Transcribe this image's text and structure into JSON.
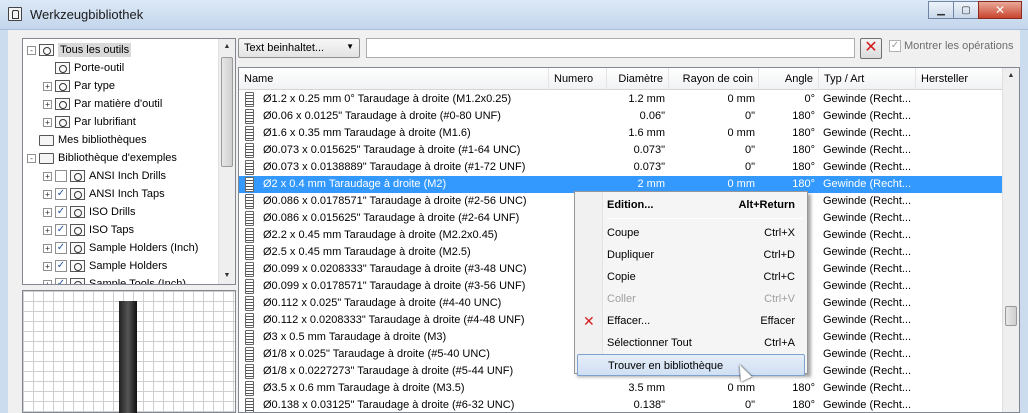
{
  "window": {
    "title": "Werkzeugbibliothek"
  },
  "tree": {
    "items": [
      {
        "label": "Tous les outils",
        "level": 0,
        "expander": "-",
        "icon": "library-icon",
        "selected": true
      },
      {
        "label": "Porte-outil",
        "level": 1,
        "expander": "",
        "icon": "tool-holder-icon"
      },
      {
        "label": "Par type",
        "level": 1,
        "expander": "+",
        "icon": "tool-type-icon"
      },
      {
        "label": "Par matière d'outil",
        "level": 1,
        "expander": "+",
        "icon": "tool-material-icon"
      },
      {
        "label": "Par lubrifiant",
        "level": 1,
        "expander": "+",
        "icon": "coolant-icon"
      },
      {
        "label": "Mes bibliothèques",
        "level": 0,
        "expander": "",
        "icon": "folder-icon"
      },
      {
        "label": "Bibliothèque d'exemples",
        "level": 0,
        "expander": "-",
        "icon": "folder-icon"
      },
      {
        "label": "ANSI Inch Drills",
        "level": 1,
        "expander": "+",
        "checked": false,
        "icon": "library-icon"
      },
      {
        "label": "ANSI Inch Taps",
        "level": 1,
        "expander": "+",
        "checked": true,
        "icon": "library-icon"
      },
      {
        "label": "ISO Drills",
        "level": 1,
        "expander": "+",
        "checked": true,
        "icon": "library-icon"
      },
      {
        "label": "ISO Taps",
        "level": 1,
        "expander": "+",
        "checked": true,
        "icon": "library-icon"
      },
      {
        "label": "Sample Holders (Inch)",
        "level": 1,
        "expander": "+",
        "checked": true,
        "icon": "library-icon"
      },
      {
        "label": "Sample Holders",
        "level": 1,
        "expander": "+",
        "checked": true,
        "icon": "library-icon"
      },
      {
        "label": "Sample Tools (Inch)",
        "level": 1,
        "expander": "+",
        "checked": true,
        "icon": "library-icon"
      }
    ]
  },
  "toolbar": {
    "filter_mode": "Text beinhaltet...",
    "search_value": "",
    "search_placeholder": "",
    "show_operations_label": "Montrer les opérations",
    "show_operations_checked": true
  },
  "grid": {
    "columns": [
      "Name",
      "Numero",
      "Diamètre",
      "Rayon de coin",
      "Angle",
      "Typ / Art",
      "Hersteller"
    ],
    "selected_row": 5,
    "rows": [
      {
        "name": "Ø1.2 x 0.25 mm 0° Taraudage à droite (M1.2x0.25)",
        "numero": "",
        "diametre": "1.2 mm",
        "rayon": "0 mm",
        "angle": "0°",
        "type": "Gewinde (Recht..."
      },
      {
        "name": "Ø0.06 x 0.0125\" Taraudage à droite (#0-80 UNF)",
        "numero": "",
        "diametre": "0.06\"",
        "rayon": "0\"",
        "angle": "180°",
        "type": "Gewinde (Recht..."
      },
      {
        "name": "Ø1.6 x 0.35 mm Taraudage à droite (M1.6)",
        "numero": "",
        "diametre": "1.6 mm",
        "rayon": "0 mm",
        "angle": "180°",
        "type": "Gewinde (Recht..."
      },
      {
        "name": "Ø0.073 x 0.015625\" Taraudage à droite (#1-64 UNC)",
        "numero": "",
        "diametre": "0.073\"",
        "rayon": "0\"",
        "angle": "180°",
        "type": "Gewinde (Recht..."
      },
      {
        "name": "Ø0.073 x 0.0138889\" Taraudage à droite (#1-72 UNF)",
        "numero": "",
        "diametre": "0.073\"",
        "rayon": "0\"",
        "angle": "180°",
        "type": "Gewinde (Recht..."
      },
      {
        "name": "Ø2 x 0.4 mm Taraudage à droite (M2)",
        "numero": "",
        "diametre": "2 mm",
        "rayon": "0 mm",
        "angle": "180°",
        "type": "Gewinde (Recht..."
      },
      {
        "name": "Ø0.086 x 0.0178571\" Taraudage à droite (#2-56 UNC)",
        "numero": "",
        "diametre": "",
        "rayon": "",
        "angle": "",
        "type": "Gewinde (Recht..."
      },
      {
        "name": "Ø0.086 x 0.015625\" Taraudage à droite (#2-64 UNF)",
        "numero": "",
        "diametre": "",
        "rayon": "",
        "angle": "",
        "type": "Gewinde (Recht..."
      },
      {
        "name": "Ø2.2 x 0.45 mm Taraudage à droite (M2.2x0.45)",
        "numero": "",
        "diametre": "",
        "rayon": "",
        "angle": "",
        "type": "Gewinde (Recht..."
      },
      {
        "name": "Ø2.5 x 0.45 mm Taraudage à droite (M2.5)",
        "numero": "",
        "diametre": "",
        "rayon": "",
        "angle": "",
        "type": "Gewinde (Recht..."
      },
      {
        "name": "Ø0.099 x 0.0208333\" Taraudage à droite (#3-48 UNC)",
        "numero": "",
        "diametre": "",
        "rayon": "",
        "angle": "",
        "type": "Gewinde (Recht..."
      },
      {
        "name": "Ø0.099 x 0.0178571\" Taraudage à droite (#3-56 UNF)",
        "numero": "",
        "diametre": "",
        "rayon": "",
        "angle": "",
        "type": "Gewinde (Recht..."
      },
      {
        "name": "Ø0.112 x 0.025\" Taraudage à droite (#4-40 UNC)",
        "numero": "",
        "diametre": "",
        "rayon": "",
        "angle": "",
        "type": "Gewinde (Recht..."
      },
      {
        "name": "Ø0.112 x 0.0208333\" Taraudage à droite (#4-48 UNF)",
        "numero": "",
        "diametre": "",
        "rayon": "",
        "angle": "",
        "type": "Gewinde (Recht..."
      },
      {
        "name": "Ø3 x 0.5 mm Taraudage à droite (M3)",
        "numero": "",
        "diametre": "",
        "rayon": "",
        "angle": "",
        "type": "Gewinde (Recht..."
      },
      {
        "name": "Ø1/8 x 0.025\" Taraudage à droite (#5-40 UNC)",
        "numero": "",
        "diametre": "",
        "rayon": "",
        "angle": "",
        "type": "Gewinde (Recht..."
      },
      {
        "name": "Ø1/8 x 0.0227273\" Taraudage à droite (#5-44 UNF)",
        "numero": "",
        "diametre": "",
        "rayon": "",
        "angle": "",
        "type": "Gewinde (Recht..."
      },
      {
        "name": "Ø3.5 x 0.6 mm Taraudage à droite (M3.5)",
        "numero": "",
        "diametre": "3.5 mm",
        "rayon": "0 mm",
        "angle": "180°",
        "type": "Gewinde (Recht..."
      },
      {
        "name": "Ø0.138 x 0.03125\" Taraudage à droite (#6-32 UNC)",
        "numero": "",
        "diametre": "0.138\"",
        "rayon": "0\"",
        "angle": "180°",
        "type": "Gewinde (Recht..."
      }
    ]
  },
  "context_menu": {
    "items": [
      {
        "label": "Edition...",
        "shortcut": "Alt+Return",
        "bold": true
      },
      {
        "separator": true
      },
      {
        "label": "Coupe",
        "shortcut": "Ctrl+X"
      },
      {
        "label": "Dupliquer",
        "shortcut": "Ctrl+D"
      },
      {
        "label": "Copie",
        "shortcut": "Ctrl+C"
      },
      {
        "label": "Coller",
        "shortcut": "Ctrl+V",
        "disabled": true
      },
      {
        "label": "Effacer...",
        "shortcut": "Effacer",
        "icon": "delete-icon"
      },
      {
        "label": "Sélectionner Tout",
        "shortcut": "Ctrl+A"
      },
      {
        "label": "Trouver en bibliothèque",
        "shortcut": "",
        "highlighted": true
      }
    ]
  },
  "colors": {
    "selection": "#3399ff",
    "delete": "#d32020"
  }
}
